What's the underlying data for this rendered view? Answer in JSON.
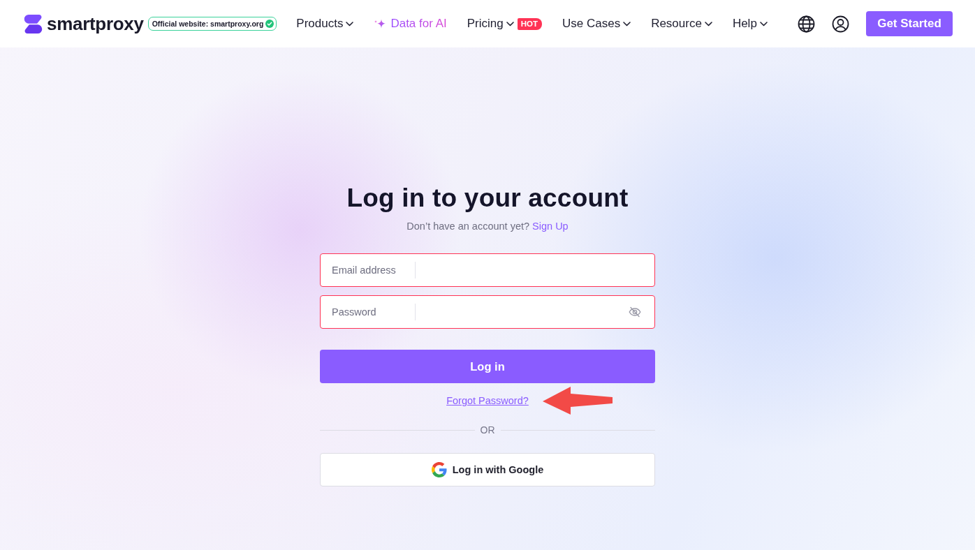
{
  "header": {
    "logo": {
      "text": "smartproxy"
    },
    "official_badge": {
      "text": "Official website: smartproxy.org",
      "verified": true
    },
    "nav": [
      {
        "label": "Products",
        "kind": "dropdown"
      },
      {
        "label": "Data for AI",
        "kind": "highlight"
      },
      {
        "label": "Pricing",
        "kind": "dropdown",
        "badge": "HOT"
      },
      {
        "label": "Use Cases",
        "kind": "dropdown"
      },
      {
        "label": "Resource",
        "kind": "dropdown"
      },
      {
        "label": "Help",
        "kind": "dropdown"
      }
    ],
    "cta": "Get Started"
  },
  "login": {
    "title": "Log in to your account",
    "signup_prompt": "Don’t have an account yet?",
    "signup_link": "Sign Up",
    "fields": [
      {
        "label": "Email address",
        "kind": "email",
        "invalid": true
      },
      {
        "label": "Password",
        "kind": "password",
        "invalid": true
      }
    ],
    "submit": "Log in",
    "forgot_link": "Forgot Password?",
    "divider": "OR",
    "google_button": "Log in with Google"
  }
}
